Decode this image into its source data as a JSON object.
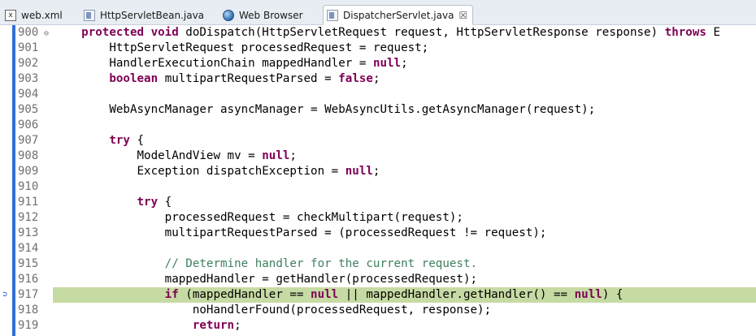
{
  "tabs": [
    {
      "label": "web.xml",
      "icon": "xml-file-icon"
    },
    {
      "label": "HttpServletBean.java",
      "icon": "java-file-icon"
    },
    {
      "label": "Web Browser",
      "icon": "globe-icon"
    },
    {
      "label": "DispatcherServlet.java",
      "icon": "java-file-icon",
      "active": true,
      "close": "☒"
    }
  ],
  "editor": {
    "current_line": "917",
    "lines": [
      {
        "num": "900",
        "fold": "⊖",
        "segments": [
          [
            "kw",
            "protected void "
          ],
          [
            "t",
            "doDispatch(HttpServletRequest request, HttpServletResponse response) "
          ],
          [
            "kw",
            "throws "
          ],
          [
            "t",
            "E"
          ]
        ],
        "indent": "    "
      },
      {
        "num": "901",
        "segments": [
          [
            "t",
            "HttpServletRequest processedRequest = request;"
          ]
        ],
        "indent": "        "
      },
      {
        "num": "902",
        "segments": [
          [
            "t",
            "HandlerExecutionChain mappedHandler = "
          ],
          [
            "kw",
            "null"
          ],
          [
            "t",
            ";"
          ]
        ],
        "indent": "        "
      },
      {
        "num": "903",
        "segments": [
          [
            "kw",
            "boolean "
          ],
          [
            "t",
            "multipartRequestParsed = "
          ],
          [
            "kw",
            "false"
          ],
          [
            "t",
            ";"
          ]
        ],
        "indent": "        "
      },
      {
        "num": "904",
        "segments": [],
        "indent": ""
      },
      {
        "num": "905",
        "segments": [
          [
            "t",
            "WebAsyncManager asyncManager = WebAsyncUtils.getAsyncManager(request);"
          ]
        ],
        "indent": "        "
      },
      {
        "num": "906",
        "segments": [],
        "indent": ""
      },
      {
        "num": "907",
        "segments": [
          [
            "kw",
            "try "
          ],
          [
            "t",
            "{"
          ]
        ],
        "indent": "        "
      },
      {
        "num": "908",
        "segments": [
          [
            "t",
            "ModelAndView mv = "
          ],
          [
            "kw",
            "null"
          ],
          [
            "t",
            ";"
          ]
        ],
        "indent": "            "
      },
      {
        "num": "909",
        "segments": [
          [
            "t",
            "Exception dispatchException = "
          ],
          [
            "kw",
            "null"
          ],
          [
            "t",
            ";"
          ]
        ],
        "indent": "            "
      },
      {
        "num": "910",
        "segments": [],
        "indent": ""
      },
      {
        "num": "911",
        "segments": [
          [
            "kw",
            "try "
          ],
          [
            "t",
            "{"
          ]
        ],
        "indent": "            "
      },
      {
        "num": "912",
        "segments": [
          [
            "t",
            "processedRequest = checkMultipart(request);"
          ]
        ],
        "indent": "                "
      },
      {
        "num": "913",
        "segments": [
          [
            "t",
            "multipartRequestParsed = (processedRequest != request);"
          ]
        ],
        "indent": "                "
      },
      {
        "num": "914",
        "segments": [],
        "indent": ""
      },
      {
        "num": "915",
        "segments": [
          [
            "cm",
            "// Determine handler for the current request."
          ]
        ],
        "indent": "                "
      },
      {
        "num": "916",
        "segments": [
          [
            "t",
            "mappedHandler = getHandler(processedRequest);"
          ]
        ],
        "indent": "                "
      },
      {
        "num": "917",
        "segments": [
          [
            "kw",
            "if "
          ],
          [
            "t",
            "(mappedHandler == "
          ],
          [
            "kw",
            "null "
          ],
          [
            "t",
            "|| mappedHandler.getHandler() == "
          ],
          [
            "kw",
            "null"
          ],
          [
            "t",
            ") {"
          ]
        ],
        "indent": "                ",
        "highlight": true
      },
      {
        "num": "918",
        "segments": [
          [
            "t",
            "noHandlerFound(processedRequest, response);"
          ]
        ],
        "indent": "                    "
      },
      {
        "num": "919",
        "segments": [
          [
            "kw",
            "return"
          ],
          [
            "t",
            ";"
          ]
        ],
        "indent": "                    "
      }
    ]
  }
}
